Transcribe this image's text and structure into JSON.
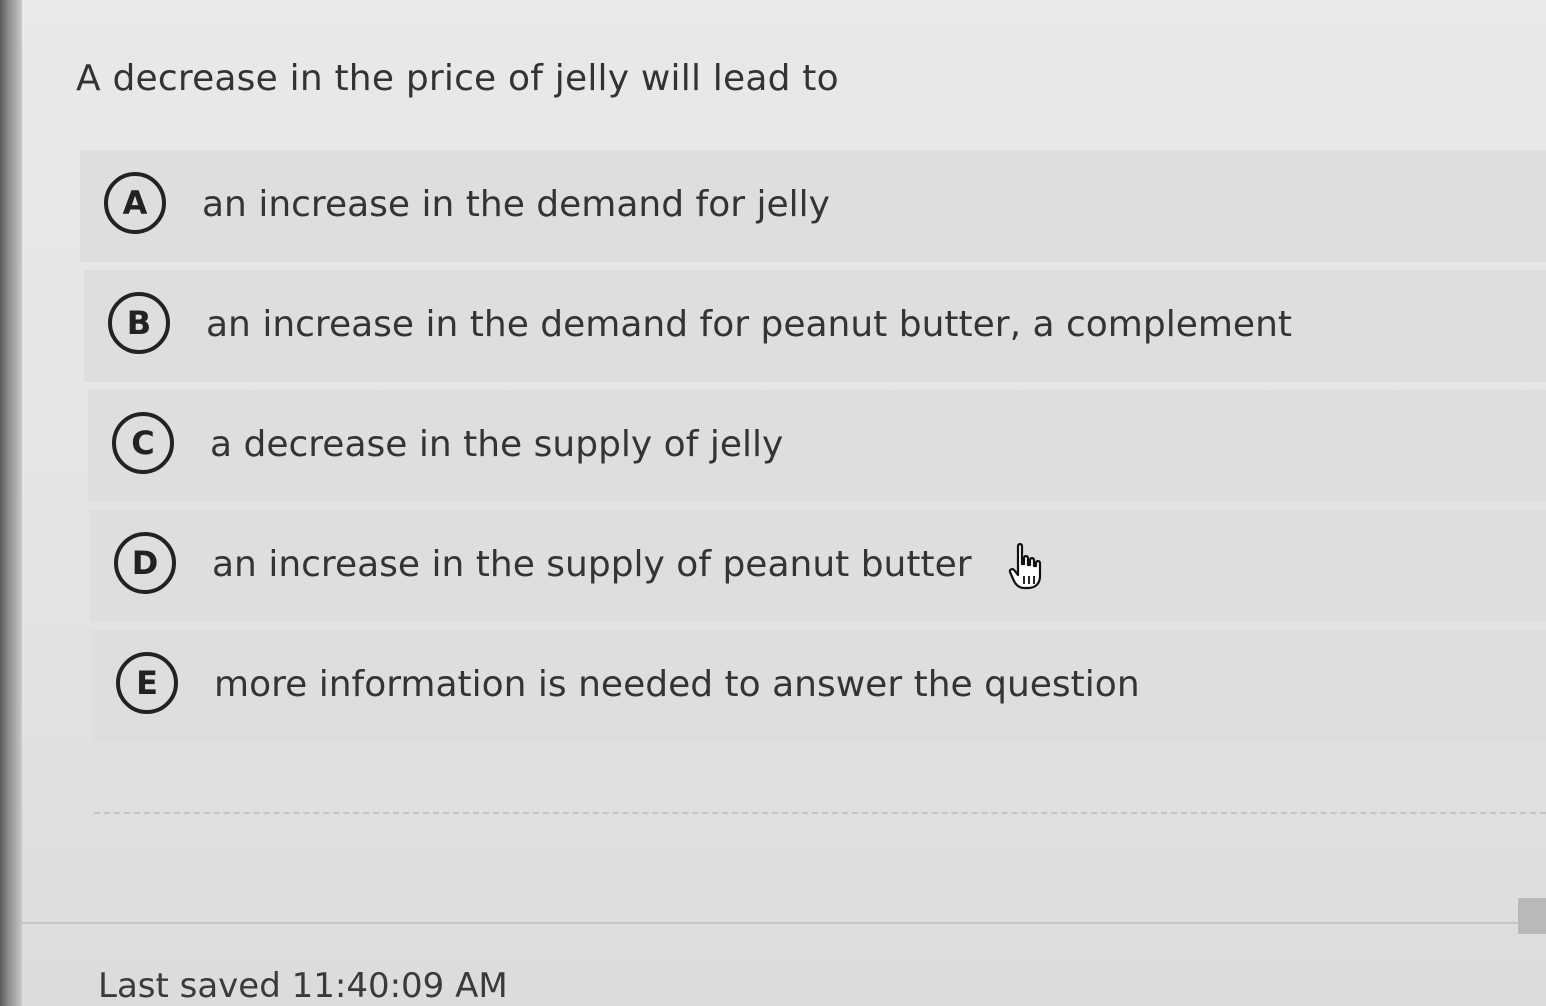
{
  "question": {
    "text": "A decrease in the price of jelly will lead to"
  },
  "options": [
    {
      "letter": "A",
      "text": "an increase in the demand for jelly"
    },
    {
      "letter": "B",
      "text": "an increase in the demand for peanut butter, a complement"
    },
    {
      "letter": "C",
      "text": "a decrease in the supply of jelly"
    },
    {
      "letter": "D",
      "text": "an increase in the supply of peanut butter"
    },
    {
      "letter": "E",
      "text": "more information is needed to answer the question"
    }
  ],
  "footer": {
    "last_saved": "Last saved 11:40:09 AM"
  },
  "cursor": {
    "icon": "hand-pointer-icon"
  },
  "colors": {
    "background": "#e6e6e4",
    "option_background": "#dededc",
    "circle_border": "#222222",
    "text": "#333333"
  }
}
